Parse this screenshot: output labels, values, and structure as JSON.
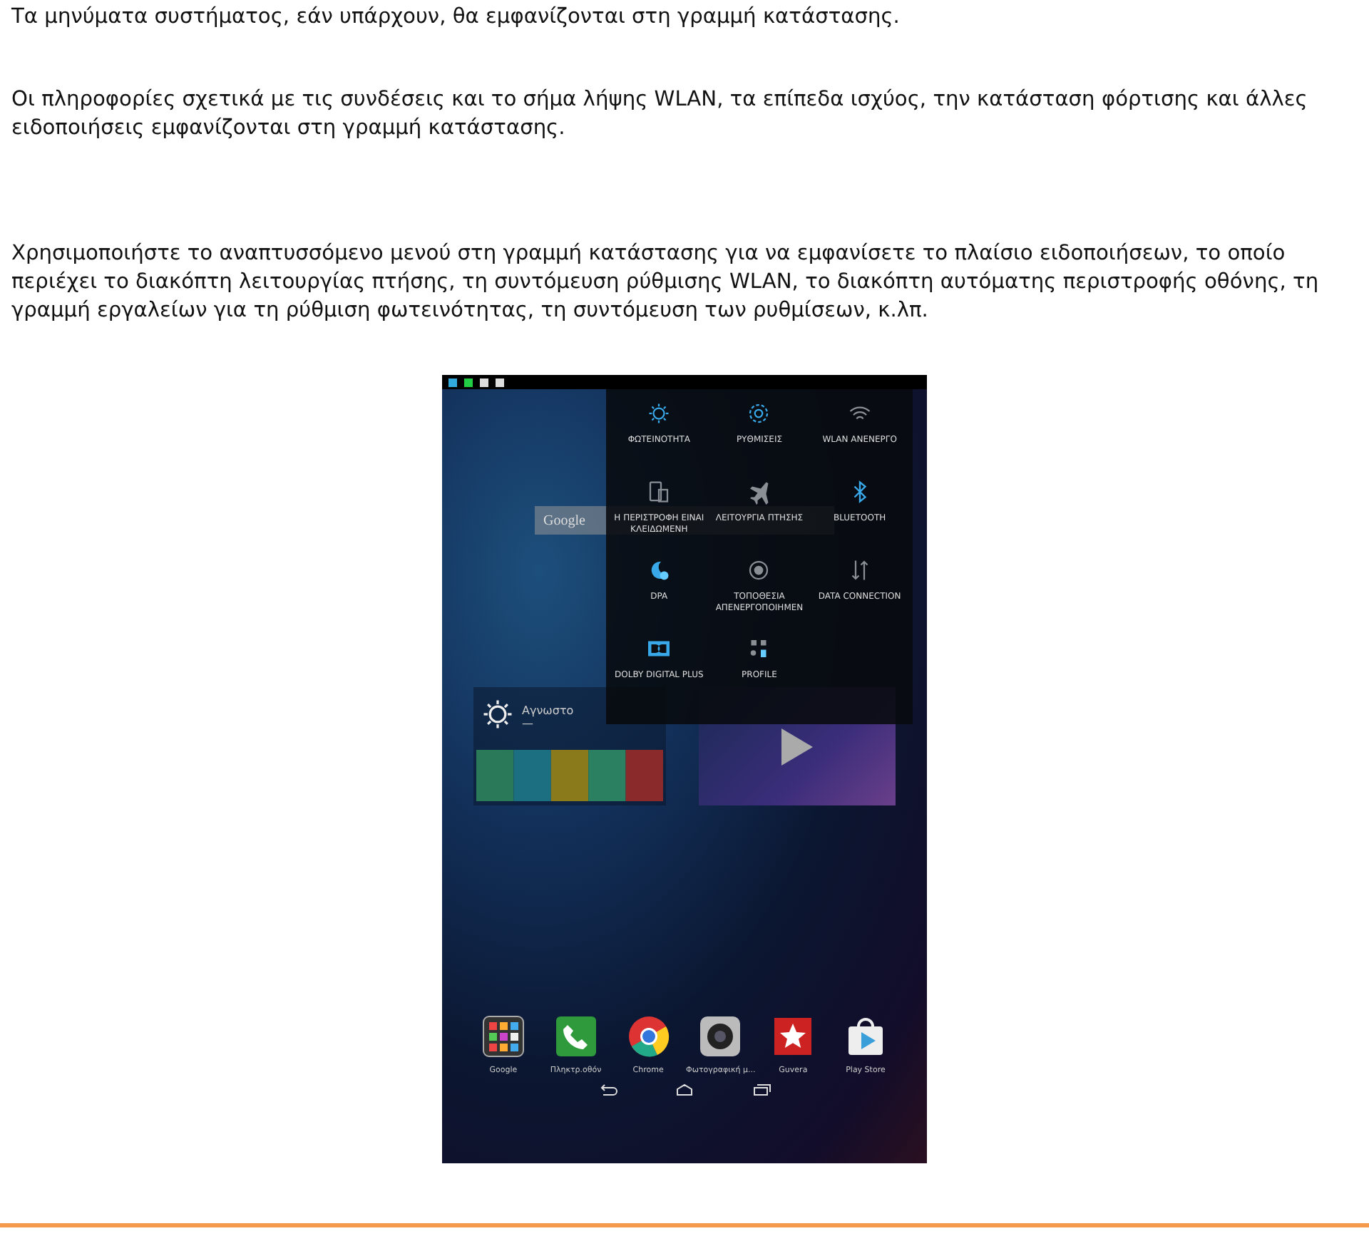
{
  "paragraphs": [
    "Τα μηνύματα συστήματος, εάν υπάρχουν, θα εμφανίζονται στη γραμμή κατάστασης.",
    "Οι πληροφορίες σχετικά με τις συνδέσεις και το σήμα λήψης WLAN, τα επίπεδα ισχύος, την κατάσταση φόρτισης και άλλες ειδοποιήσεις εμφανίζονται στη γραμμή κατάστασης.",
    "Χρησιμοποιήστε το αναπτυσσόμενο μενού στη γραμμή κατάστασης για να εμφανίσετε το πλαίσιο ειδοποιήσεων, το οποίο περιέχει το διακόπτη λειτουργίας πτήσης, τη συντόμευση ρύθμισης WLAN, το διακόπτη αυτόματης περιστροφής οθόνης, τη γραμμή εργαλείων για τη ρύθμιση φωτεινότητας, τη συντόμευση των ρυθμίσεων, κ.λπ."
  ],
  "tablet": {
    "search_logo": "Google",
    "weather": {
      "condition": "Αγνωστο",
      "temperature": "—"
    },
    "quick_settings": [
      {
        "kind": "sun",
        "label": "ΦΩΤΕΙΝΟΤΗΤΑ",
        "on": true
      },
      {
        "kind": "gear",
        "label": "ΡΥΘΜΙΣΕΙΣ",
        "on": true
      },
      {
        "kind": "wifi",
        "label": "WLAN ΑΝΕΝΕΡΓΟ",
        "on": false
      },
      {
        "kind": "rotate",
        "label": "Η ΠΕΡΙΣΤΡΟΦΗ ΕΙΝΑΙ ΚΛΕΙΔΩΜΕΝΗ",
        "on": false
      },
      {
        "kind": "plane",
        "label": "ΛΕΙΤΟΥΡΓΙΑ ΠΤΗΣΗΣ",
        "on": false
      },
      {
        "kind": "bluetooth",
        "label": "BLUETOOTH",
        "on": true
      },
      {
        "kind": "dpa",
        "label": "DPA",
        "on": true
      },
      {
        "kind": "location",
        "label": "ΤΟΠΟΘΕΣΙΑ ΑΠΕΝΕΡΓΟΠΟΙΗΜΕΝ",
        "on": false
      },
      {
        "kind": "data",
        "label": "DATA CONNECTION",
        "on": false
      },
      {
        "kind": "dolby",
        "label": "DOLBY DIGITAL PLUS",
        "on": true
      },
      {
        "kind": "profile",
        "label": "PROFILE",
        "on": false
      }
    ],
    "dock": [
      {
        "kind": "folder",
        "label": "Google"
      },
      {
        "kind": "phone",
        "label": "Πληκτρ.οθόν"
      },
      {
        "kind": "chrome",
        "label": "Chrome"
      },
      {
        "kind": "camera",
        "label": "Φωτογραφική μ..."
      },
      {
        "kind": "star",
        "label": "Guvera"
      },
      {
        "kind": "store",
        "label": "Play Store"
      }
    ]
  }
}
